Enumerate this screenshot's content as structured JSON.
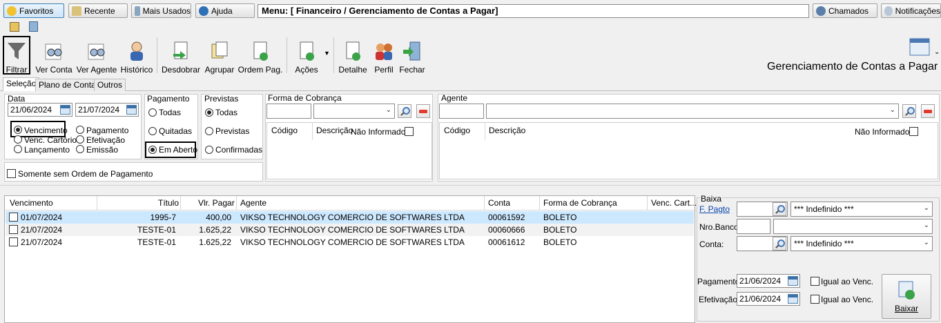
{
  "topbar": {
    "favoritos": "Favoritos",
    "recente": "Recente",
    "mais_usados": "Mais Usados",
    "ajuda": "Ajuda",
    "menu_path": "Menu: [ Financeiro / Gerenciamento de Contas a Pagar]",
    "chamados": "Chamados",
    "notificacoes": "Notificações"
  },
  "toolbar": {
    "filtrar": "Filtrar",
    "ver_conta": "Ver Conta",
    "ver_agente": "Ver Agente",
    "historico": "Histórico",
    "desdobrar": "Desdobrar",
    "agrupar": "Agrupar",
    "ordem_pag": "Ordem Pag.",
    "acoes": "Ações",
    "detalhe": "Detalhe",
    "perfil": "Perfil",
    "fechar": "Fechar"
  },
  "window_title": "Gerenciamento de Contas a Pagar",
  "tabs": [
    "Seleção",
    "Plano de Conta",
    "Outros"
  ],
  "filters": {
    "data_label": "Data",
    "date_from": "21/06/2024",
    "date_to": "21/07/2024",
    "date_types": {
      "vencimento": "Vencimento",
      "pagamento": "Pagamento",
      "venc_cartorio": "Venc. Cartório",
      "efetivacao": "Efetivação",
      "lancamento": "Lançamento",
      "emissao": "Emissão"
    },
    "pagamento_label": "Pagamento",
    "pagamento_opts": {
      "todas": "Todas",
      "quitadas": "Quitadas",
      "em_aberto": "Em Aberto"
    },
    "previstas_label": "Previstas",
    "previstas_opts": {
      "todas": "Todas",
      "previstas": "Previstas",
      "confirmadas": "Confirmadas"
    },
    "somente_sem_ordem": "Somente sem Ordem de Pagamento"
  },
  "forma_cobranca": {
    "title": "Forma de Cobrança",
    "col_codigo": "Código",
    "col_descricao": "Descrição",
    "nao_informado": "Não Informado"
  },
  "agente": {
    "title": "Agente",
    "col_codigo": "Código",
    "col_descricao": "Descrição",
    "nao_informado": "Não Informado"
  },
  "grid": {
    "headers": [
      "Vencimento",
      "Título",
      "Vlr. Pagar",
      "Agente",
      "Conta",
      "Forma de Cobrança",
      "Venc. Cart..."
    ],
    "rows": [
      [
        "01/07/2024",
        "1995-7",
        "400,00",
        "VIKSO TECHNOLOGY COMERCIO DE SOFTWARES LTDA",
        "00061592",
        "BOLETO"
      ],
      [
        "21/07/2024",
        "TESTE-01",
        "1.625,22",
        "VIKSO TECHNOLOGY COMERCIO DE SOFTWARES LTDA",
        "00060666",
        "BOLETO"
      ],
      [
        "21/07/2024",
        "TESTE-01",
        "1.625,22",
        "VIKSO TECHNOLOGY COMERCIO DE SOFTWARES LTDA",
        "00061612",
        "BOLETO"
      ]
    ]
  },
  "baixa": {
    "title": "Baixa",
    "f_pagto": "F. Pagto",
    "f_pagto_value": "*** Indefinido ***",
    "nro_banco": "Nro.Banco",
    "conta": "Conta:",
    "conta_value": "*** Indefinido ***",
    "pagamento": "Pagamento",
    "pagamento_date": "21/06/2024",
    "efetivacao": "Efetivação",
    "efetivacao_date": "21/06/2024",
    "igual_venc": "Igual ao Venc.",
    "baixar": "Baixar"
  }
}
